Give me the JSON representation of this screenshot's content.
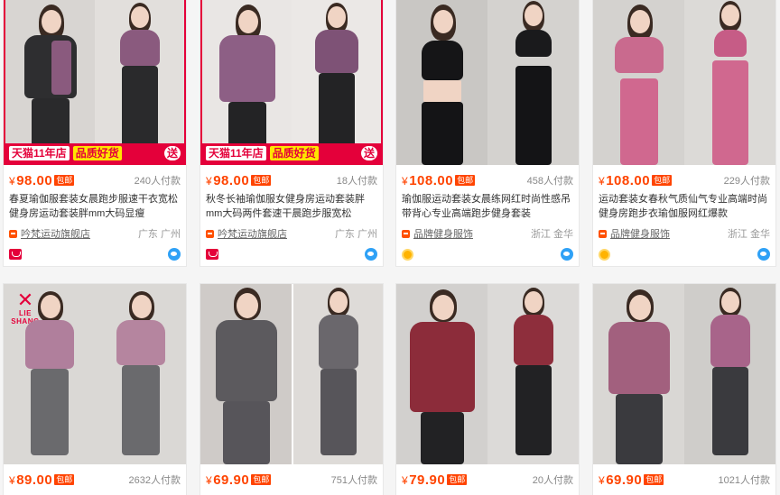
{
  "products": [
    {
      "price": "98.00",
      "baoyou": "包邮",
      "sold": "240人付款",
      "title": "春夏瑜伽服套装女晨跑步服速干衣宽松健身房运动套装胖mm大码显瘦",
      "shop": "吟梵运动旗舰店",
      "location": "广东 广州",
      "badge": "tmall-icon",
      "promo": {
        "tmall": "天猫11年店",
        "quality": "品质好货",
        "gift": "送"
      },
      "colors": {
        "bg": "#d8d5d2",
        "top_l": "#2e2e30",
        "top_r": "#8a5a7e",
        "legs": "#2a2a2c"
      }
    },
    {
      "price": "98.00",
      "baoyou": "包邮",
      "sold": "18人付款",
      "title": "秋冬长袖瑜伽服女健身房运动套装胖mm大码两件套速干晨跑步服宽松",
      "shop": "吟梵运动旗舰店",
      "location": "广东 广州",
      "badge": "tmall-icon",
      "promo": {
        "tmall": "天猫11年店",
        "quality": "品质好货",
        "gift": "送"
      },
      "colors": {
        "bg": "#e9e6e4",
        "top_l": "#8d5f85",
        "top_r": "#7e5276",
        "legs": "#232325"
      }
    },
    {
      "price": "108.00",
      "baoyou": "包邮",
      "sold": "458人付款",
      "title": "瑜伽服运动套装女晨练网红时尚性感吊带背心专业高端跑步健身套装",
      "shop": "品牌健身服饰",
      "location": "浙江 金华",
      "badge": "gold-medal-icon",
      "colors": {
        "bg": "#c9c7c4",
        "top_l": "#151517",
        "top_r": "#1a1a1c",
        "legs": "#141416"
      }
    },
    {
      "price": "108.00",
      "baoyou": "包邮",
      "sold": "229人付款",
      "title": "运动套装女春秋气质仙气专业高端时尚健身房跑步衣瑜伽服网红爆款",
      "shop": "品牌健身服饰",
      "location": "浙江 金华",
      "badge": "gold-medal-icon",
      "colors": {
        "bg": "#d4d2cf",
        "top_l": "#c96a8e",
        "top_r": "#c65c86",
        "legs": "#d0688f"
      }
    },
    {
      "price": "89.00",
      "baoyou": "包邮",
      "sold": "2632人付款",
      "logo": {
        "mark": "✕",
        "name": "LIE SHANG"
      },
      "colors": {
        "bg": "#dad8d5",
        "top_l": "#b07f9c",
        "top_r": "#b5859f",
        "legs": "#6a6a6d"
      }
    },
    {
      "price": "69.90",
      "baoyou": "包邮",
      "sold": "751人付款",
      "colors": {
        "bg": "#cfcbc8",
        "top_l": "#5c5a5e",
        "top_r": "#6a676c",
        "legs": "#57555a"
      }
    },
    {
      "price": "79.90",
      "baoyou": "包邮",
      "sold": "20人付款",
      "colors": {
        "bg": "#d2d0ce",
        "top_l": "#8c2c3a",
        "top_r": "#8e2e3c",
        "legs": "#222224"
      }
    },
    {
      "price": "69.90",
      "baoyou": "包邮",
      "sold": "1021人付款",
      "colors": {
        "bg": "#d9d7d4",
        "top_l": "#a2607e",
        "top_r": "#a8648a",
        "legs": "#3a3a3e"
      }
    }
  ],
  "currency": "¥"
}
